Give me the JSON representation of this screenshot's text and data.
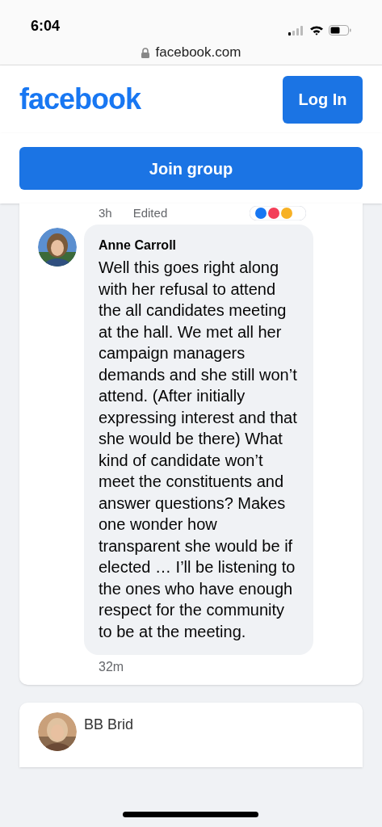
{
  "status_bar": {
    "time": "6:04"
  },
  "browser": {
    "url": "facebook.com"
  },
  "header": {
    "logo": "facebook",
    "login_button": "Log In"
  },
  "join_button": "Join group",
  "previous_comment": {
    "time": "3h",
    "edited": "Edited"
  },
  "comment": {
    "author": "Anne Carroll",
    "text": "Well this goes right along with her refusal to attend the all candidates meeting at the hall. We met all her campaign managers demands and she still won’t attend. (After initially expressing interest and that she would be there) What kind of candidate won’t meet the constituents and answer questions? Makes one wonder how transparent she would be if elected … I’ll be listening to the ones who have enough respect for the community to be at the meeting.",
    "time": "32m"
  },
  "next_comment": {
    "author": "BB Brid"
  }
}
